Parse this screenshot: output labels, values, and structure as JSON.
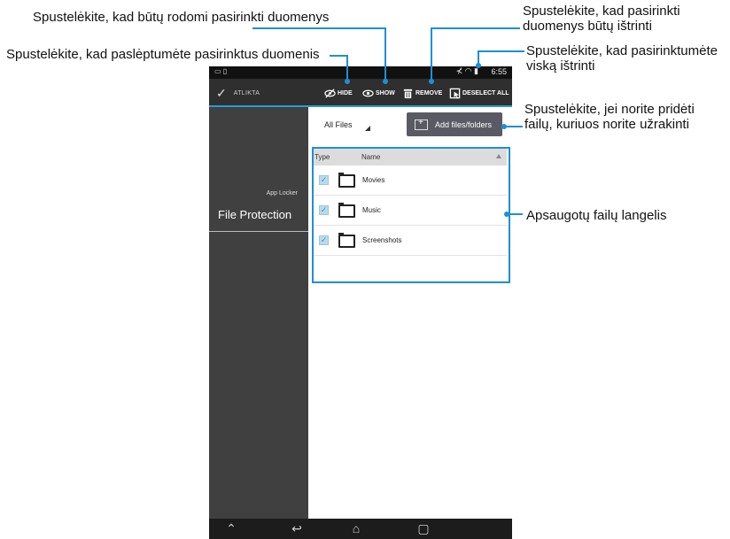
{
  "callouts": {
    "show": "Spustelėkite, kad būtų rodomi pasirinkti duomenys",
    "hide": "Spustelėkite, kad paslėptumėte pasirinktus duomenis",
    "remove_1": "Spustelėkite, kad pasirinkti",
    "remove_2": "duomenys būtų ištrinti",
    "deselect_1": "Spustelėkite, kad pasirinktumėte",
    "deselect_2": "viską ištrinti",
    "add_1": "Spustelėkite, jei norite pridėti",
    "add_2": "failų, kuriuos norite užrakinti",
    "pane": "Apsaugotų failų langelis"
  },
  "status_bar": {
    "time": "6:55"
  },
  "action_bar": {
    "done_label": "ATLIKTA",
    "hide_label": "HIDE",
    "show_label": "SHOW",
    "remove_label": "REMOVE",
    "deselect_label": "DESELECT ALL"
  },
  "sidebar": {
    "section": "App Locker",
    "item": "File Protection"
  },
  "content": {
    "filter": "All Files",
    "add_button": "Add files/folders",
    "columns": {
      "type": "Type",
      "name": "Name"
    },
    "rows": [
      {
        "name": "Movies",
        "checked": true
      },
      {
        "name": "Music",
        "checked": true
      },
      {
        "name": "Screenshots",
        "checked": true
      }
    ]
  },
  "colors": {
    "accent": "#2b9bd6",
    "callout_line": "#1e8fd4",
    "sidebar": "#404040",
    "action_bar": "#2f2f2f"
  },
  "icons": {
    "done": "check-icon",
    "hide": "eye-slash-icon",
    "show": "eye-icon",
    "remove": "trash-icon",
    "deselect": "deselect-icon",
    "add": "add-folder-icon",
    "folder": "folder-icon",
    "nav_back": "back-icon",
    "nav_home": "home-icon",
    "nav_recent": "recent-apps-icon",
    "nav_hide": "hide-keyboard-icon"
  }
}
